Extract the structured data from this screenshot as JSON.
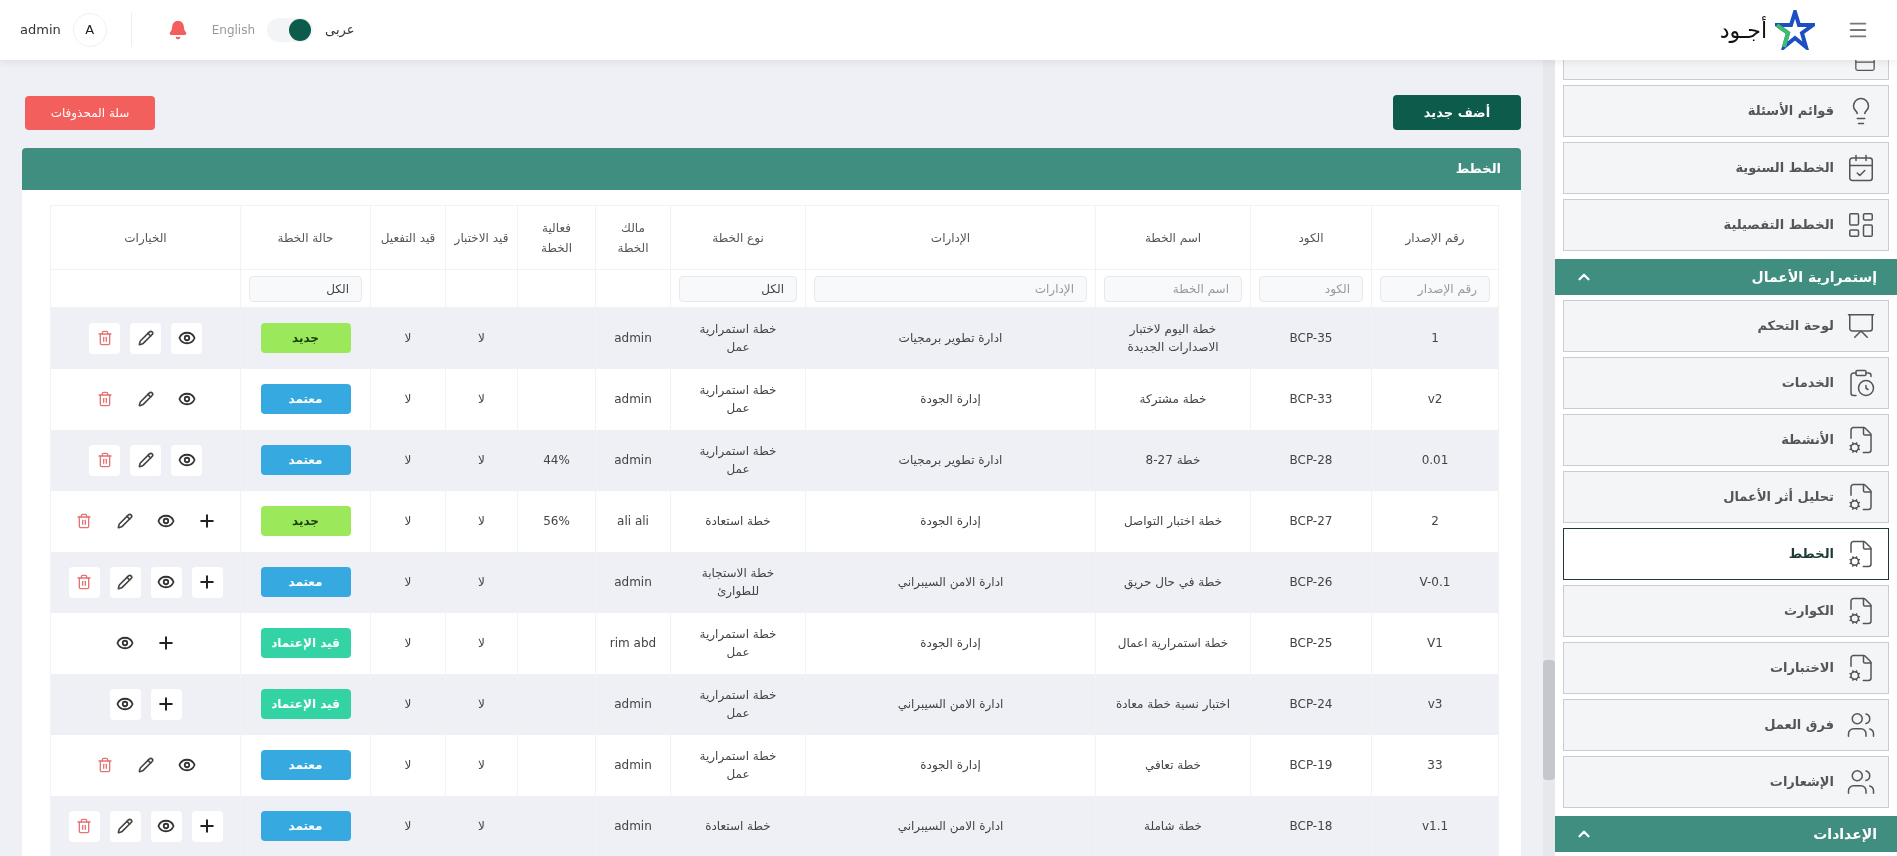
{
  "header": {
    "logo_text": "أجـود",
    "user": {
      "name": "admin",
      "initial": "A"
    },
    "language": {
      "left_label": "English",
      "right_label": "عربى",
      "on": true
    }
  },
  "actions": {
    "add": "أضف جديد",
    "trash": "سلة المحذوفات"
  },
  "panel": {
    "title": "الخطط"
  },
  "table": {
    "columns": [
      {
        "label": "رقم الإصدار",
        "filter": {
          "kind": "input",
          "placeholder": "رقم الإصدار"
        }
      },
      {
        "label": "الكود",
        "filter": {
          "kind": "input",
          "placeholder": "الكود"
        }
      },
      {
        "label": "اسم الخطة",
        "filter": {
          "kind": "input",
          "placeholder": "اسم الخطة"
        }
      },
      {
        "label": "الإدارات",
        "filter": {
          "kind": "input",
          "placeholder": "الإدارات"
        }
      },
      {
        "label": "نوع الخطة",
        "filter": {
          "kind": "select",
          "value": "الكل"
        }
      },
      {
        "label": "مالك الخطة"
      },
      {
        "label": "فعالية الخطة"
      },
      {
        "label": "قيد الاختبار"
      },
      {
        "label": "قيد التفعيل"
      },
      {
        "label": "حالة الخطة",
        "filter": {
          "kind": "select",
          "value": "الكل"
        }
      },
      {
        "label": "الخيارات"
      }
    ],
    "rows": [
      {
        "version": "1",
        "code": "BCP-35",
        "name": "خطة اليوم لاختبار الاصدارات الجديدة",
        "department": "ادارة تطوير برمجيات",
        "type": "خطة استمرارية عمل",
        "owner": "admin",
        "test": "لا",
        "activation": "لا",
        "status": {
          "kind": "new",
          "label": "جديد"
        },
        "options": [
          {
            "kind": "view"
          },
          {
            "kind": "edit"
          },
          {
            "kind": "delete"
          }
        ]
      },
      {
        "version": "v2",
        "code": "BCP-33",
        "name": "خطة مشتركة",
        "department": "إدارة الجودة",
        "type": "خطة استمرارية عمل",
        "owner": "admin",
        "test": "لا",
        "activation": "لا",
        "status": {
          "kind": "approved",
          "label": "معتمد"
        },
        "options": [
          {
            "kind": "view"
          },
          {
            "kind": "edit"
          },
          {
            "kind": "delete"
          }
        ]
      },
      {
        "version": "0.01",
        "code": "BCP-28",
        "name": "خطة 27-8",
        "department": "ادارة تطوير برمجيات",
        "type": "خطة استمرارية عمل",
        "owner": "admin",
        "effectiveness": "44%",
        "test": "لا",
        "activation": "لا",
        "status": {
          "kind": "approved",
          "label": "معتمد"
        },
        "options": [
          {
            "kind": "view"
          },
          {
            "kind": "edit"
          },
          {
            "kind": "delete"
          }
        ]
      },
      {
        "version": "2",
        "code": "BCP-27",
        "name": "خطة اختبار التواصل",
        "department": "إدارة الجودة",
        "type": "خطة استعادة",
        "owner": "ali ali",
        "effectiveness": "56%",
        "test": "لا",
        "activation": "لا",
        "status": {
          "kind": "new",
          "label": "جديد"
        },
        "options": [
          {
            "kind": "add"
          },
          {
            "kind": "view"
          },
          {
            "kind": "edit"
          },
          {
            "kind": "delete"
          }
        ]
      },
      {
        "version": "V-0.1",
        "code": "BCP-26",
        "name": "خطة في حال حريق",
        "department": "ادارة الامن السيبراني",
        "type": "خطة الاستجابة للطوارئ",
        "owner": "admin",
        "test": "لا",
        "activation": "لا",
        "status": {
          "kind": "approved",
          "label": "معتمد"
        },
        "options": [
          {
            "kind": "add"
          },
          {
            "kind": "view"
          },
          {
            "kind": "edit"
          },
          {
            "kind": "delete"
          }
        ]
      },
      {
        "version": "V1",
        "code": "BCP-25",
        "name": "خطة استمرارية اعمال",
        "department": "إدارة الجودة",
        "type": "خطة استمرارية عمل",
        "owner": "rim abd",
        "test": "لا",
        "activation": "لا",
        "status": {
          "kind": "pending",
          "label": "قيد الإعتماد"
        },
        "options": [
          {
            "kind": "add"
          },
          {
            "kind": "view"
          }
        ]
      },
      {
        "version": "v3",
        "code": "BCP-24",
        "name": "اختبار نسبة خطة معادة",
        "department": "ادارة الامن السيبراني",
        "type": "خطة استمرارية عمل",
        "owner": "admin",
        "test": "لا",
        "activation": "لا",
        "status": {
          "kind": "pending",
          "label": "قيد الإعتماد"
        },
        "options": [
          {
            "kind": "add"
          },
          {
            "kind": "view"
          }
        ]
      },
      {
        "version": "33",
        "code": "BCP-19",
        "name": "خطة تعافي",
        "department": "إدارة الجودة",
        "type": "خطة استمرارية عمل",
        "owner": "admin",
        "test": "لا",
        "activation": "لا",
        "status": {
          "kind": "approved",
          "label": "معتمد"
        },
        "options": [
          {
            "kind": "view"
          },
          {
            "kind": "edit"
          },
          {
            "kind": "delete"
          }
        ]
      },
      {
        "version": "v1.1",
        "code": "BCP-18",
        "name": "خطة شاملة",
        "department": "ادارة الامن السيبراني",
        "type": "خطة استعادة",
        "owner": "admin",
        "test": "لا",
        "activation": "لا",
        "status": {
          "kind": "approved",
          "label": "معتمد"
        },
        "options": [
          {
            "kind": "add"
          },
          {
            "kind": "view"
          },
          {
            "kind": "edit"
          },
          {
            "kind": "delete"
          }
        ]
      }
    ]
  },
  "sidebar": {
    "top_items": [
      {
        "label": "قوائم الأسئلة",
        "selected": false
      },
      {
        "label": "الخطط السنوية",
        "selected": false
      },
      {
        "label": "الخطط التفصيلية",
        "selected": false
      }
    ],
    "sections": [
      {
        "title": "إستمرارية الأعمال",
        "expanded": true,
        "items": [
          {
            "label": "لوحة التحكم",
            "selected": false
          },
          {
            "label": "الخدمات",
            "selected": false
          },
          {
            "label": "الأنشطة",
            "selected": false
          },
          {
            "label": "تحليل أثر الأعمال",
            "selected": false
          },
          {
            "label": "الخطط",
            "selected": true
          },
          {
            "label": "الكوارث",
            "selected": false
          },
          {
            "label": "الاختبارات",
            "selected": false
          },
          {
            "label": "فرق العمل",
            "selected": false
          },
          {
            "label": "الإشعارات",
            "selected": false
          }
        ]
      },
      {
        "title": "الإعدادات",
        "expanded": true
      }
    ]
  }
}
